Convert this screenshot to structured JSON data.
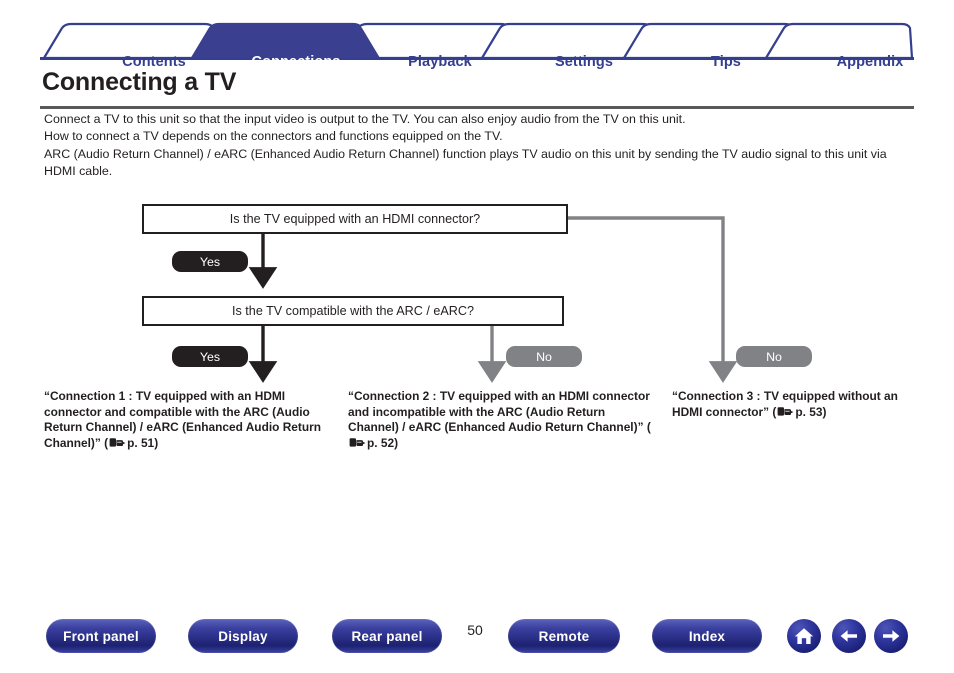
{
  "tabs": [
    {
      "label": "Contents",
      "active": false
    },
    {
      "label": "Connections",
      "active": true
    },
    {
      "label": "Playback",
      "active": false
    },
    {
      "label": "Settings",
      "active": false
    },
    {
      "label": "Tips",
      "active": false
    },
    {
      "label": "Appendix",
      "active": false
    }
  ],
  "page_title": "Connecting a TV",
  "intro": {
    "line1": "Connect a TV to this unit so that the input video is output to the TV. You can also enjoy audio from the TV on this unit.",
    "line2": "How to connect a TV depends on the connectors and functions equipped on the TV.",
    "line3": "ARC (Audio Return Channel) / eARC (Enhanced Audio Return Channel) function plays TV audio on this unit by sending the TV audio signal to this unit via",
    "line4": "HDMI cable."
  },
  "flowchart": {
    "question1": "Is the TV equipped with an HDMI connector?",
    "question2": "Is the TV compatible with the ARC / eARC?",
    "yes1": "Yes",
    "yes2": "Yes",
    "no_middle": "No",
    "no_right": "No"
  },
  "links": {
    "connection1": {
      "text": "“Connection 1 : TV equipped with an HDMI connector and compatible with the ARC (Audio Return Channel) / eARC (Enhanced Audio Return Channel)” (",
      "page": "p. 51",
      "close": ")"
    },
    "connection2": {
      "text": "“Connection 2 : TV equipped with an HDMI connector and incompatible with the ARC (Audio Return Channel) / eARC (Enhanced Audio Return Channel)” (",
      "page": "p. 52",
      "close": ")"
    },
    "connection3": {
      "text": "“Connection 3 : TV equipped without an HDMI connector” (",
      "page": "p. 53",
      "close": ")"
    }
  },
  "footer": {
    "buttons": [
      {
        "label": "Front panel"
      },
      {
        "label": "Display"
      },
      {
        "label": "Rear panel"
      },
      {
        "label": "Remote"
      },
      {
        "label": "Index"
      }
    ],
    "page_number": "50",
    "icons": [
      {
        "name": "home-icon"
      },
      {
        "name": "back-arrow-icon"
      },
      {
        "name": "forward-arrow-icon"
      }
    ]
  },
  "colors": {
    "brand_blue": "#353f8f",
    "tab_active_fill": "#3a3f8f",
    "rule_gray": "#58595b",
    "ink": "#231f20",
    "gray_arrow": "#808285"
  }
}
